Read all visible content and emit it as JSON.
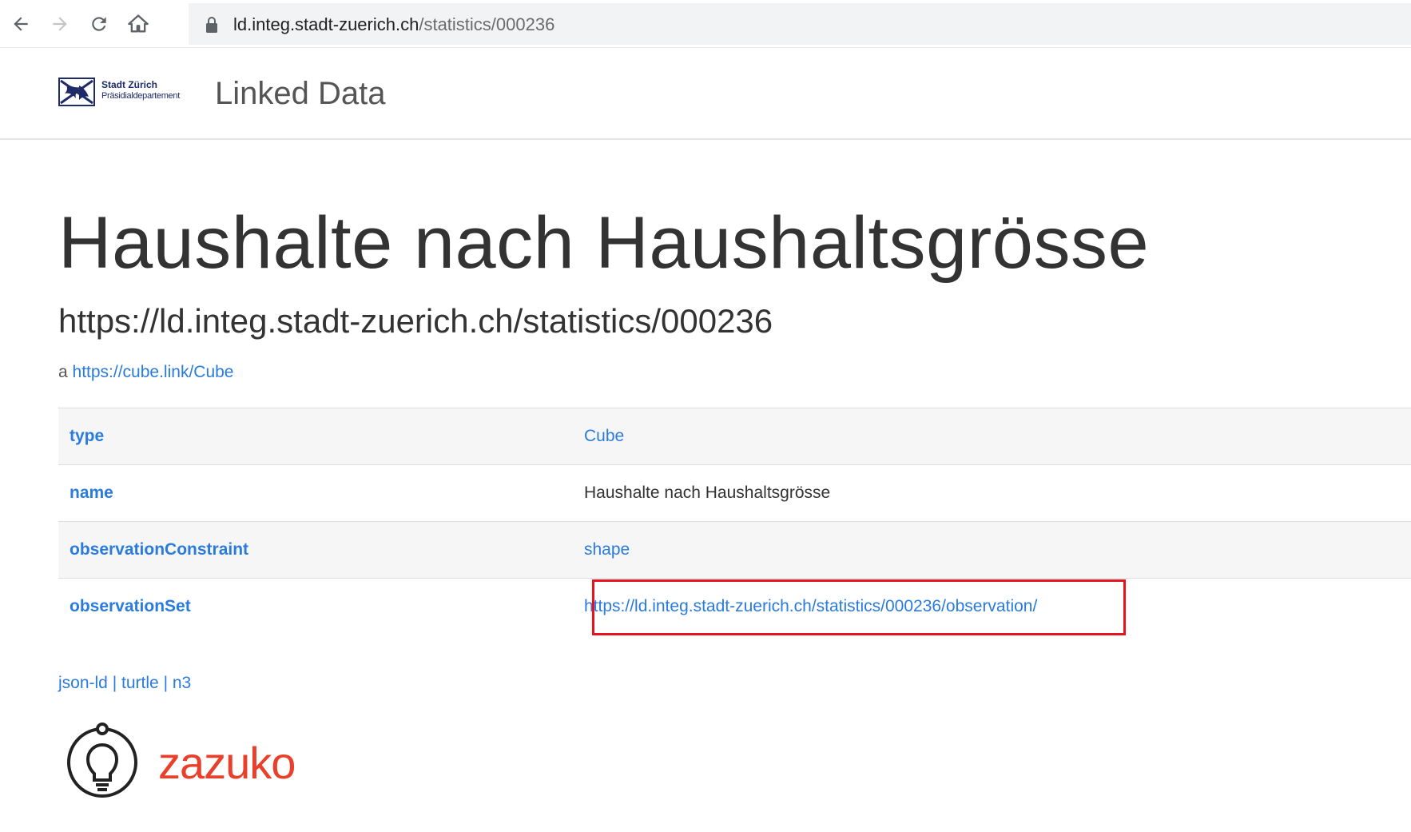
{
  "browser": {
    "url_host": "ld.integ.stadt-zuerich.ch",
    "url_path": "/statistics/000236",
    "icons": [
      "back-arrow-icon",
      "forward-arrow-icon",
      "reload-icon",
      "home-icon",
      "lock-icon"
    ]
  },
  "header": {
    "logo_line1": "Stadt Zürich",
    "logo_line2": "Präsidialdepartement",
    "site_title": "Linked Data"
  },
  "main": {
    "title": "Haushalte nach Haushaltsgrösse",
    "uri": "https://ld.integ.stadt-zuerich.ch/statistics/000236",
    "type_prefix": "a",
    "type_link": "https://cube.link/Cube"
  },
  "properties": [
    {
      "key": "type",
      "value": "Cube",
      "value_is_link": true
    },
    {
      "key": "name",
      "value": "Haushalte nach Haushaltsgrösse",
      "value_is_link": false
    },
    {
      "key": "observationConstraint",
      "value": "shape",
      "value_is_link": true
    },
    {
      "key": "observationSet",
      "value": "https://ld.integ.stadt-zuerich.ch/statistics/000236/observation/",
      "value_is_link": true
    }
  ],
  "formats": {
    "jsonld": "json-ld",
    "sep": "|",
    "turtle": "turtle",
    "n3": "n3"
  },
  "footer": {
    "brand": "zazuko"
  },
  "colors": {
    "link": "#2a7bde",
    "highlight": "#e8121b",
    "brand": "#e8402a"
  }
}
